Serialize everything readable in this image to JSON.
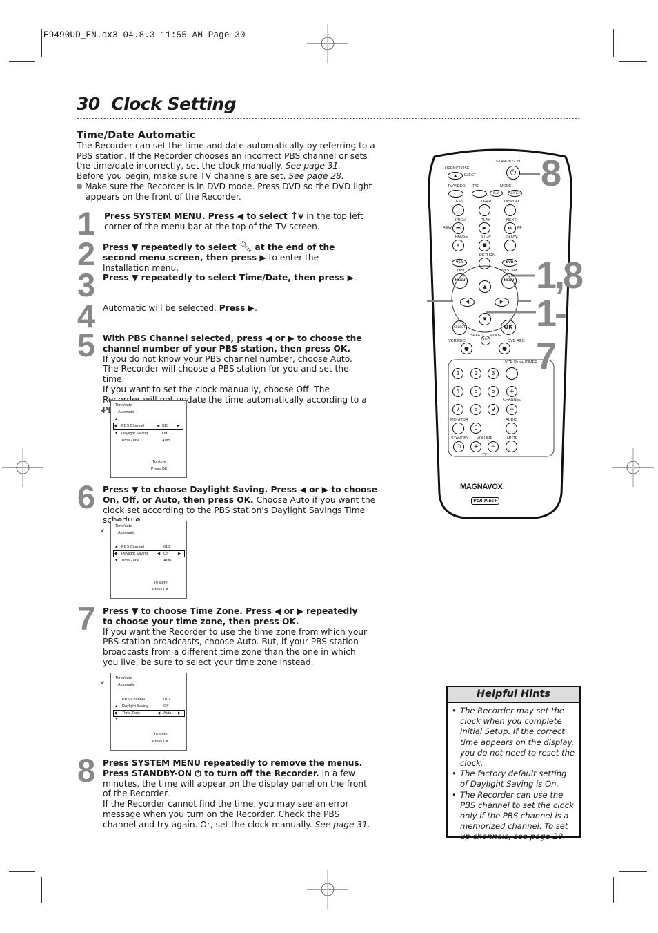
{
  "slug": "E9490UD_EN.qx3  04.8.3  11:55 AM  Page 30",
  "page": {
    "number": "30",
    "title": "Clock Setting"
  },
  "section": {
    "heading": "Time/Date Automatic",
    "intro_1": "The Recorder can set the time and date automatically by referring to a PBS station. If the Recorder chooses an incorrect PBS channel or sets the time/date incorrectly, set the clock manually. ",
    "intro_1_ref": "See page 31.",
    "intro_2": "Before you begin, make sure TV channels are set. ",
    "intro_2_ref": "See page 28.",
    "bullet": "Make sure the Recorder is in DVD mode. Press DVD so the DVD light appears on the front of the Recorder."
  },
  "steps": [
    {
      "num": "1",
      "bold": "Press SYSTEM MENU. Press ◀ to select",
      "icon": "setup-icon",
      "rest": " in the top left corner of the menu bar at the top of the TV screen."
    },
    {
      "num": "2",
      "bold": "Press ▼ repeatedly to select",
      "bold2": " at the end of the second menu screen, then press ▶",
      "rest": " to enter the Installation menu."
    },
    {
      "num": "3",
      "bold": "Press ▼ repeatedly to select Time/Date, then press ▶",
      "rest": "."
    },
    {
      "num": "4",
      "plain": "Automatic will be selected. ",
      "bold": "Press ▶",
      "rest": "."
    },
    {
      "num": "5",
      "bold": "With PBS Channel selected, press ◀ or ▶ to choose the channel number of your PBS station, then press OK.",
      "rest1": "If you do not know your PBS channel number, choose Auto. The Recorder will choose a PBS station for you and set the time.",
      "rest2": "If you want to set the clock manually, choose Off. The Recorder will not update the time automatically according to a PBS station."
    },
    {
      "num": "6",
      "bold": "Press ▼ to choose Daylight Saving. Press ◀ or ▶ to choose On, Off, or Auto, then press OK.",
      "rest": " Choose Auto if you want the clock set according to the PBS station's Daylight Savings Time schedule."
    },
    {
      "num": "7",
      "bold": "Press ▼ to choose Time Zone. Press ◀ or ▶  repeatedly to choose your time zone, then press OK.",
      "rest": "If you want the Recorder to use the time zone from which your PBS station broadcasts, choose Auto. But, if your PBS station broadcasts from a different time zone than the one in which you live, be sure to select your time zone instead."
    },
    {
      "num": "8",
      "bold": "Press SYSTEM MENU repeatedly to remove the menus. Press STANDBY-ON ⏻ to turn off the Recorder.",
      "rest1": " In a few minutes, the time will appear on the display panel on the front of the Recorder.",
      "rest2": "If the Recorder cannot find the time, you may see an error message when you turn on the Recorder. Check the PBS channel and try again. Or, set the clock manually. ",
      "rest2_ref": "See page 31."
    }
  ],
  "osd_screens": [
    {
      "title": "Time/date",
      "subtitle": "Automatic",
      "rows": [
        {
          "label": "PBS Channel",
          "value": "010",
          "selected": true
        },
        {
          "label": "Daylight Saving",
          "value": "Off",
          "selected": false
        },
        {
          "label": "Time Zone",
          "value": "Auto.",
          "selected": false
        }
      ],
      "footer1": "To store",
      "footer2": "Press OK"
    },
    {
      "title": "Time/date",
      "subtitle": "Automatic",
      "rows": [
        {
          "label": "PBS Channel",
          "value": "010",
          "selected": false
        },
        {
          "label": "Daylight Saving",
          "value": "Off",
          "selected": true
        },
        {
          "label": "Time Zone",
          "value": "Auto.",
          "selected": false
        }
      ],
      "footer1": "To store",
      "footer2": "Press OK"
    },
    {
      "title": "Time/date",
      "subtitle": "Automatic",
      "rows": [
        {
          "label": "PBS Channel",
          "value": "010",
          "selected": false
        },
        {
          "label": "Daylight Saving",
          "value": "Off",
          "selected": false
        },
        {
          "label": "Time Zone",
          "value": "Auto.",
          "selected": true
        }
      ],
      "footer1": "To store",
      "footer2": "Press OK"
    }
  ],
  "hints": {
    "title": "Helpful Hints",
    "items": [
      "The Recorder may set the clock when you complete Initial Setup. If the correct time appears on the display, you do not need to reset the clock.",
      "The factory default setting of Daylight Saving is On.",
      "The Recorder can use the PBS channel to set the clock only if the PBS channel is a memorized channel. To set up channels, see page 28."
    ]
  },
  "remote": {
    "brand": "MAGNAVOX",
    "logo": "VCR Plus+",
    "callouts": [
      "8",
      "1,8",
      "1-7"
    ],
    "labels": {
      "standby_on": "STANDBY-ON",
      "open_close": "OPEN/CLOSE",
      "eject": "EJECT",
      "tv_video": "TV/VIDEO",
      "tc": "T/C",
      "mode": "MODE",
      "play_small": "PLAY",
      "search": "SEARCH",
      "fss": "FSS",
      "clear": "CLEAR",
      "display": "DISPLAY",
      "prev": "PREV",
      "play": "PLAY",
      "next": "NEXT",
      "rew": "REW",
      "ff": "FF",
      "pause": "PAUSE",
      "stop": "STOP",
      "slow": "SLOW",
      "return": "RETURN",
      "vcr": "VCR",
      "dvd": "DVD",
      "disc": "DISC",
      "system": "SYSTEM",
      "menu": "MENU",
      "select": "SELECT",
      "ok": "OK",
      "speed": "SPEED",
      "mode2": "MODE",
      "rec": "REC",
      "vcr_rec": "VCR REC",
      "dvd_rec": "DVD REC",
      "vcr_plus_timer": "VCR Plus+ /TIMER",
      "channel": "CHANNEL",
      "monitor": "MONITOR",
      "audio": "AUDIO",
      "standby": "STANDBY",
      "volume": "VOLUME",
      "mute": "MUTE",
      "tv": "TV"
    },
    "digits": [
      "1",
      "2",
      "3",
      "4",
      "5",
      "6",
      "7",
      "8",
      "9",
      "0"
    ]
  }
}
